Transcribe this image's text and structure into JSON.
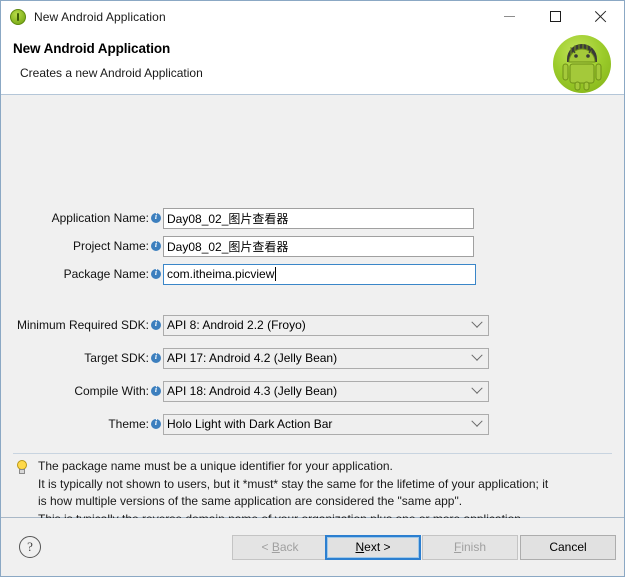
{
  "window": {
    "title": "New Android Application",
    "icon": "android-circle-icon",
    "controls": {
      "minimize": "minimize-icon",
      "maximize": "maximize-icon",
      "close": "close-icon"
    }
  },
  "header": {
    "title": "New Android Application",
    "description": "Creates a new Android Application",
    "logo": "android-robot-logo"
  },
  "form": {
    "fields": [
      {
        "label": "Application Name:",
        "value": "Day08_02_图片查看器",
        "type": "text",
        "focused": false
      },
      {
        "label": "Project Name:",
        "value": "Day08_02_图片查看器",
        "type": "text",
        "focused": false
      },
      {
        "label": "Package Name:",
        "value": "com.itheima.picview",
        "type": "text",
        "focused": true
      }
    ],
    "dropdowns": [
      {
        "label": "Minimum Required SDK:",
        "value": "API 8: Android 2.2 (Froyo)"
      },
      {
        "label": "Target SDK:",
        "value": "API 17: Android 4.2 (Jelly Bean)"
      },
      {
        "label": "Compile With:",
        "value": "API 18: Android 4.3 (Jelly Bean)"
      },
      {
        "label": "Theme:",
        "value": "Holo Light with Dark Action Bar"
      }
    ]
  },
  "hint": {
    "icon": "lightbulb-icon",
    "lines": [
      "The package name must be a unique identifier for your application.",
      "It is typically not shown to users, but it *must* stay the same for the lifetime of your application; it",
      "is how multiple versions of the same application are considered the \"same app\".",
      "This is typically the reverse domain name of your organization plus one or more application"
    ]
  },
  "buttons": {
    "help": "?",
    "back": {
      "label": "< Back",
      "enabled": false
    },
    "next": {
      "label": "Next >",
      "enabled": true,
      "focused": true
    },
    "finish": {
      "label": "Finish",
      "enabled": false
    },
    "cancel": {
      "label": "Cancel",
      "enabled": true
    }
  },
  "colors": {
    "accent": "#2c7fd0",
    "dialog_bg": "#f0f0f0",
    "android_green": "#9ccc2b",
    "info_blue": "#3c7fbe",
    "bulb_yellow": "#ffd94a"
  }
}
